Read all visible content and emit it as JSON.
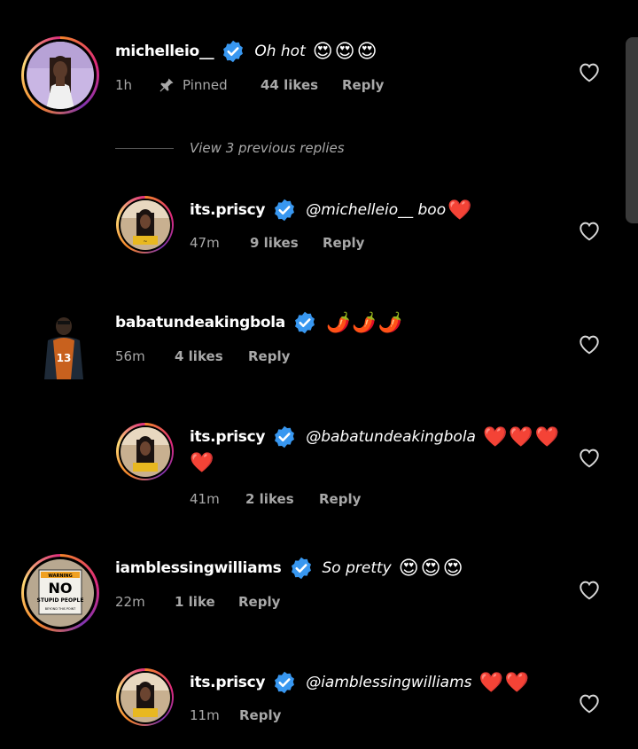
{
  "colors": {
    "background": "#000000",
    "verified": "#3897f0",
    "meta": "#a8a8a8",
    "heart_red": "#e0245e"
  },
  "comments": [
    {
      "username": "michelleio__",
      "text": "Oh hot",
      "emojis": "😍😍😍",
      "time": "1h",
      "pinned": "Pinned",
      "likes": "44 likes",
      "reply": "Reply"
    },
    {
      "username": "its.priscy",
      "text": "@michelleio__ boo",
      "emojis": "❤️",
      "time": "47m",
      "likes": "9 likes",
      "reply": "Reply"
    },
    {
      "username": "babatundeakingbola",
      "text": "",
      "emojis": "🌶️🌶️🌶️",
      "time": "56m",
      "likes": "4 likes",
      "reply": "Reply"
    },
    {
      "username": "its.priscy",
      "text": "@babatundeakingbola",
      "emojis": "❤️❤️❤️",
      "emojis_line2": "❤️",
      "time": "41m",
      "likes": "2 likes",
      "reply": "Reply"
    },
    {
      "username": "iamblessingwilliams",
      "text": "So pretty",
      "emojis": "😍😍😍",
      "time": "22m",
      "likes": "1 like",
      "reply": "Reply"
    },
    {
      "username": "its.priscy",
      "text": "@iamblessingwilliams",
      "emojis": "❤️❤️",
      "time": "11m",
      "reply": "Reply"
    }
  ],
  "view_replies": "View 3 previous replies",
  "sign": {
    "top": "WARNING",
    "main": "NO",
    "sub": "STUPID PEOPLE",
    "small": "BEYOND THIS POINT"
  },
  "jersey_number": "13",
  "icons": [
    "verified-badge-icon",
    "heart-outline-icon",
    "pin-icon"
  ]
}
